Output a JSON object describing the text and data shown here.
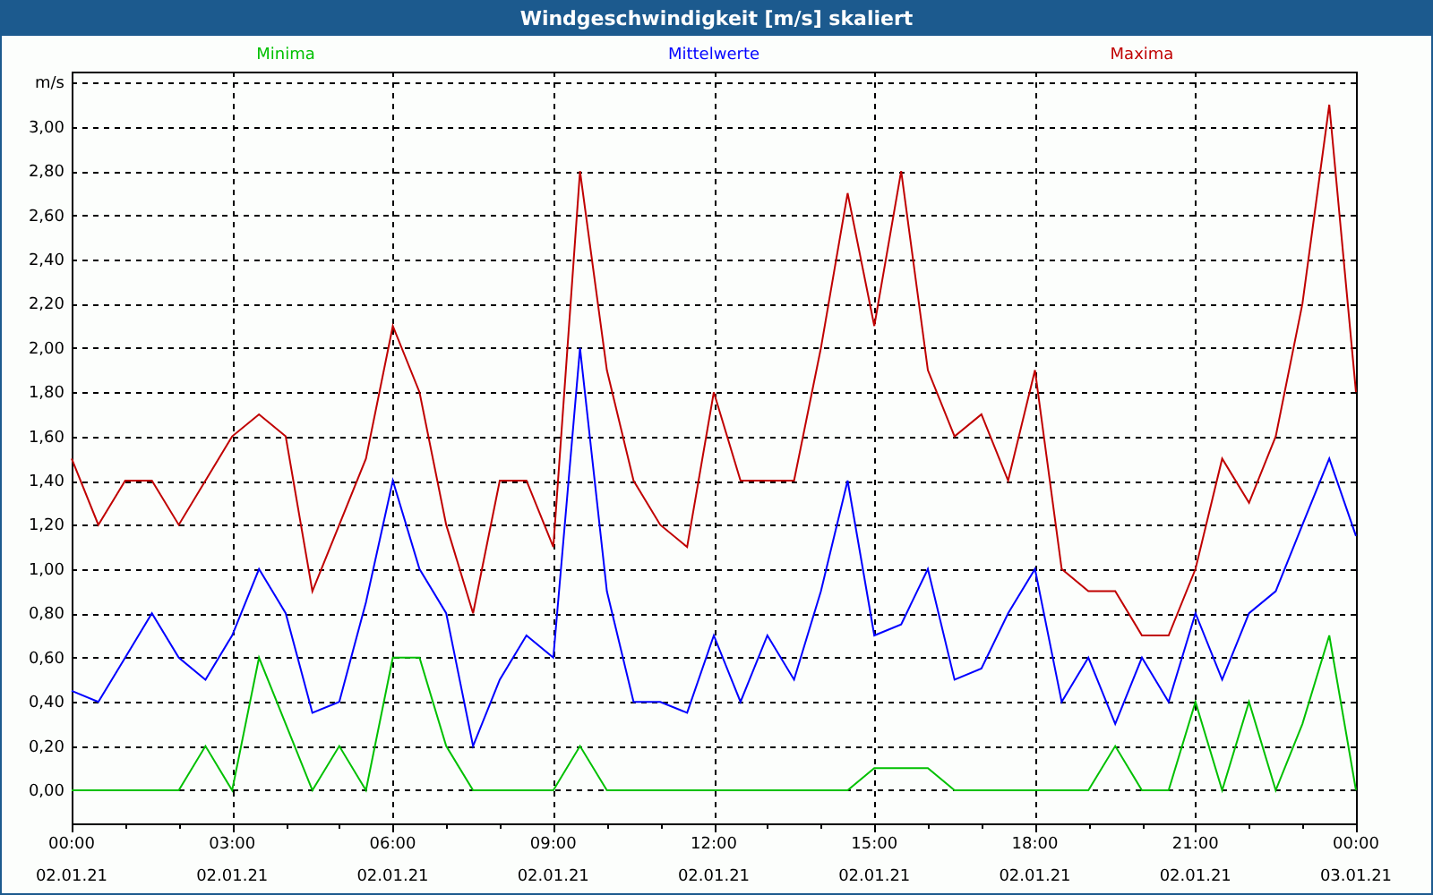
{
  "window": {
    "title": "Windgeschwindigkeit [m/s] skaliert"
  },
  "chart": {
    "chart_data": {
      "type": "line",
      "grid": true,
      "ylabel": "m/s",
      "xlim": [
        0,
        24
      ],
      "ylim": [
        -0.15,
        3.25
      ],
      "x": [
        0,
        0.5,
        1,
        1.5,
        2,
        2.5,
        3,
        3.5,
        4,
        4.5,
        5,
        5.5,
        6,
        6.5,
        7,
        7.5,
        8,
        8.5,
        9,
        9.5,
        10,
        10.5,
        11,
        11.5,
        12,
        12.5,
        13,
        13.5,
        14,
        14.5,
        15,
        15.5,
        16,
        16.5,
        17,
        17.5,
        18,
        18.5,
        19,
        19.5,
        20,
        20.5,
        21,
        21.5,
        22,
        22.5,
        23,
        23.5,
        24
      ],
      "series": [
        {
          "name": "Minima",
          "color": "#00c000",
          "values": [
            0,
            0,
            0,
            0,
            0,
            0.2,
            0,
            0.6,
            0.3,
            0,
            0.2,
            0,
            0.6,
            0.6,
            0.2,
            0,
            0,
            0,
            0,
            0.2,
            0,
            0,
            0,
            0,
            0,
            0,
            0,
            0,
            0,
            0,
            0.1,
            0.1,
            0.1,
            0,
            0,
            0,
            0,
            0,
            0,
            0.2,
            0,
            0,
            0.4,
            0,
            0.4,
            0,
            0.3,
            0.7,
            0
          ]
        },
        {
          "name": "Mittelwerte",
          "color": "#0000ff",
          "values": [
            0.45,
            0.4,
            0.6,
            0.8,
            0.6,
            0.5,
            0.7,
            1.0,
            0.8,
            0.35,
            0.4,
            0.85,
            1.4,
            1.0,
            0.8,
            0.2,
            0.5,
            0.7,
            0.6,
            2.0,
            0.9,
            0.4,
            0.4,
            0.35,
            0.7,
            0.4,
            0.7,
            0.5,
            0.9,
            1.4,
            0.7,
            0.75,
            1.0,
            0.5,
            0.55,
            0.8,
            1.0,
            0.4,
            0.6,
            0.3,
            0.6,
            0.4,
            0.8,
            0.5,
            0.8,
            0.9,
            1.2,
            1.5,
            1.15
          ]
        },
        {
          "name": "Maxima",
          "color": "#c00000",
          "values": [
            1.5,
            1.2,
            1.4,
            1.4,
            1.2,
            1.4,
            1.6,
            1.7,
            1.6,
            0.9,
            1.2,
            1.5,
            2.1,
            1.8,
            1.2,
            0.8,
            1.4,
            1.4,
            1.1,
            2.8,
            1.9,
            1.4,
            1.2,
            1.1,
            1.8,
            1.4,
            1.4,
            1.4,
            2.0,
            2.7,
            2.1,
            2.8,
            1.9,
            1.6,
            1.7,
            1.4,
            1.9,
            1.0,
            0.9,
            0.9,
            0.7,
            0.7,
            1.0,
            1.5,
            1.3,
            1.6,
            2.2,
            3.1,
            1.8
          ]
        }
      ],
      "yticks": [
        {
          "value": 0,
          "label": "0,00"
        },
        {
          "value": 0.2,
          "label": "0,20"
        },
        {
          "value": 0.4,
          "label": "0,40"
        },
        {
          "value": 0.6,
          "label": "0,60"
        },
        {
          "value": 0.8,
          "label": "0,80"
        },
        {
          "value": 1.0,
          "label": "1,00"
        },
        {
          "value": 1.2,
          "label": "1,20"
        },
        {
          "value": 1.4,
          "label": "1,40"
        },
        {
          "value": 1.6,
          "label": "1,60"
        },
        {
          "value": 1.8,
          "label": "1,80"
        },
        {
          "value": 2.0,
          "label": "2,00"
        },
        {
          "value": 2.2,
          "label": "2,20"
        },
        {
          "value": 2.4,
          "label": "2,40"
        },
        {
          "value": 2.6,
          "label": "2,60"
        },
        {
          "value": 2.8,
          "label": "2,80"
        },
        {
          "value": 3.0,
          "label": "3,00"
        }
      ],
      "xticks": [
        {
          "value": 0,
          "label": "00:00"
        },
        {
          "value": 3,
          "label": "03:00"
        },
        {
          "value": 6,
          "label": "06:00"
        },
        {
          "value": 9,
          "label": "09:00"
        },
        {
          "value": 12,
          "label": "12:00"
        },
        {
          "value": 15,
          "label": "15:00"
        },
        {
          "value": 18,
          "label": "18:00"
        },
        {
          "value": 21,
          "label": "21:00"
        },
        {
          "value": 24,
          "label": "00:00"
        }
      ]
    },
    "tick_dates": [
      "02.01.21",
      "02.01.21",
      "02.01.21",
      "02.01.21",
      "02.01.21",
      "02.01.21",
      "02.01.21",
      "02.01.21",
      "03.01.21"
    ]
  }
}
